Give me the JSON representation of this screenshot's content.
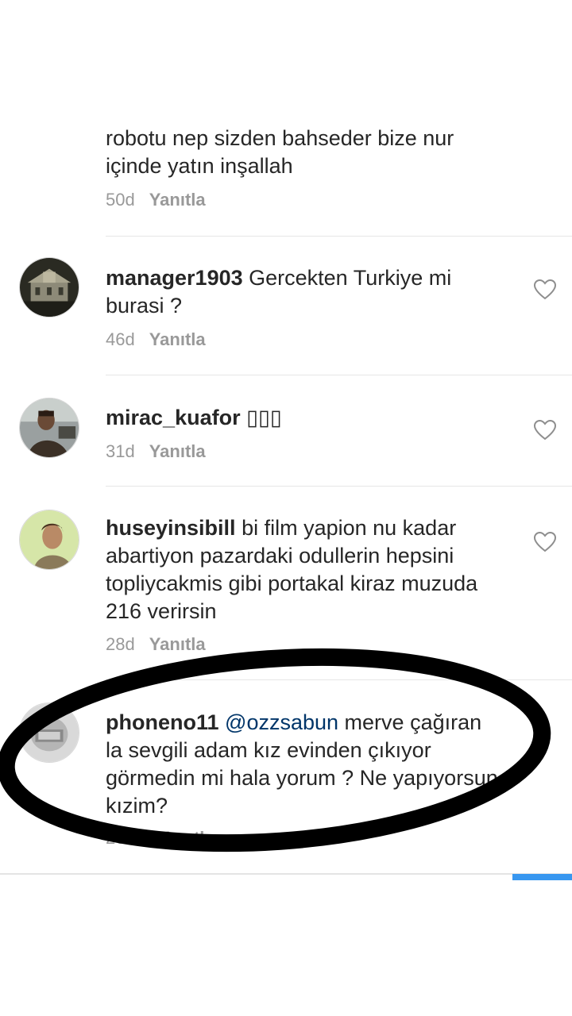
{
  "reply_label": "Yanıtla",
  "comments": [
    {
      "text_line_partial": "robotu nep sizden bahseder bize nur",
      "text_line2": "içinde yatın inşallah",
      "age": "50d",
      "reply": "Yanıtla"
    },
    {
      "username": "manager1903",
      "text": "Gercekten Turkiye mi burasi ?",
      "age": "46d",
      "reply": "Yanıtla"
    },
    {
      "username": "mirac_kuafor",
      "text": "▯▯▯",
      "age": "31d",
      "reply": "Yanıtla"
    },
    {
      "username": "huseyinsibill",
      "text": "bi film yapion nu kadar abartiyon pazardaki odullerin hepsini topliycakmis gibi portakal kiraz muzuda 216 verirsin",
      "age": "28d",
      "reply": "Yanıtla"
    },
    {
      "username": "phoneno11",
      "mention": "@ozzsabun",
      "text": "merve çağıran la sevgili adam kız evinden çıkıyor görmedin mi hala yorum ? Ne yapıyorsun kızim?",
      "age": "20sn",
      "reply": "Yanıtla"
    }
  ],
  "colors": {
    "text": "#262626",
    "meta": "#999999",
    "mention": "#003569",
    "accent": "#3897f0",
    "annotation": "#000000"
  },
  "icons": {
    "like": "heart-outline-icon"
  }
}
